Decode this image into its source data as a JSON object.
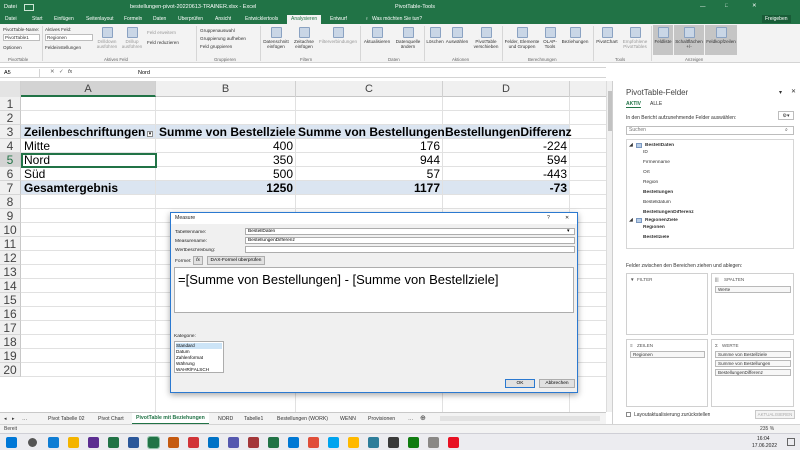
{
  "titlebar": {
    "autosave": "Datei",
    "filename": "bestellungen-pivot-20220613-TRAINER.xlsx - Excel",
    "context": "PivotTable-Tools",
    "user": "Freigeben"
  },
  "ribbon_tabs": [
    "Datei",
    "Start",
    "Einfügen",
    "Seitenlayout",
    "Formeln",
    "Daten",
    "Überprüfen",
    "Ansicht",
    "Entwicklertools",
    "Analysieren",
    "Entwurf"
  ],
  "tell_me": "Was möchten Sie tun?",
  "ribbon": {
    "pt_name_label": "PivotTable-Name:",
    "pt_name": "PivotTable1",
    "options": "Optionen",
    "active_field_label": "Aktives Feld:",
    "active_field": "Regionen",
    "field_settings": "Feldeinstellungen",
    "group_pivottable": "PivotTable",
    "group_active_field": "Aktives Feld",
    "drilldown": "Drilldown ausführen",
    "drillup": "Drillup ausführen",
    "expand": "Feld erweitern",
    "collapse": "Feld reduzieren",
    "group_selection": "Gruppenauswahl",
    "ungroup": "Gruppierung aufheben",
    "group_field": "Feld gruppieren",
    "group_grouping": "Gruppieren",
    "slicer": "Datenschnitt einfügen",
    "timeline": "Zeitachse einfügen",
    "filter_conn": "Filterverbindungen",
    "group_filter": "Filtern",
    "refresh": "Aktualisieren",
    "change_source": "Datenquelle ändern",
    "group_data": "Daten",
    "clear": "Löschen",
    "select": "Auswählen",
    "move": "PivotTable verschieben",
    "group_actions": "Aktionen",
    "fields_items": "Felder, Elemente und Gruppen",
    "olap": "OLAP-Tools",
    "relationships": "Beziehungen",
    "group_calc": "Berechnungen",
    "pivotchart": "PivotChart",
    "recommended": "Empfohlene PivotTables",
    "group_tools": "Tools",
    "field_list": "Feldliste",
    "buttons": "Schaltflächen +/-",
    "headers": "Feldkopfzeilen",
    "group_show": "Anzeigen"
  },
  "formula_bar": {
    "name_box": "A5",
    "fx": "fx",
    "content": "Nord"
  },
  "columns": [
    "A",
    "B",
    "C",
    "D"
  ],
  "rows": [
    "1",
    "2",
    "3",
    "4",
    "5",
    "6",
    "7",
    "8",
    "9",
    "10",
    "11",
    "12",
    "13",
    "14",
    "15",
    "16",
    "17",
    "18",
    "19",
    "20"
  ],
  "pivot": {
    "header": [
      "Zeilenbeschriftungen",
      "Summe von Bestellziele",
      "Summe von Bestellungen",
      "BestellungenDifferenz"
    ],
    "data": [
      [
        "Mitte",
        "400",
        "176",
        "-224"
      ],
      [
        "Nord",
        "350",
        "944",
        "594"
      ],
      [
        "Süd",
        "500",
        "57",
        "-443"
      ]
    ],
    "total": [
      "Gesamtergebnis",
      "1250",
      "1177",
      "-73"
    ]
  },
  "sheet_tabs": [
    "Pivot Tabelle 02",
    "Pivot Chart",
    "PivotTable mit Beziehungen",
    "NORD",
    "Tabelle1",
    "Bestellungen (WORK)",
    "WENN",
    "Provisionen"
  ],
  "status": {
    "mode": "Bereit",
    "zoom": "235 %"
  },
  "pane": {
    "title": "PivotTable-Felder",
    "tab_active": "AKTIV",
    "tab_all": "ALLE",
    "instruction": "In den Bericht aufzunehmende Felder auswählen:",
    "search_placeholder": "Suchen",
    "tables": [
      {
        "name": "BestellDaten",
        "fields": [
          {
            "label": "ID",
            "checked": false
          },
          {
            "label": "Firmenname",
            "checked": false
          },
          {
            "label": "Ort",
            "checked": false
          },
          {
            "label": "Region",
            "checked": false
          },
          {
            "label": "Bestellungen",
            "checked": true
          },
          {
            "label": "Bestelldatum",
            "checked": false
          },
          {
            "label": "BestellungenDifferenz",
            "checked": true
          }
        ]
      },
      {
        "name": "RegionenZiele",
        "fields": [
          {
            "label": "Regionen",
            "checked": true
          },
          {
            "label": "Bestellziele",
            "checked": true
          }
        ]
      }
    ],
    "drag_hint": "Felder zwischen den Bereichen ziehen und ablegen:",
    "area_filter": "FILTER",
    "area_columns": "SPALTEN",
    "area_rows": "ZEILEN",
    "area_values": "WERTE",
    "columns_items": [
      "Werte"
    ],
    "rows_items": [
      "Regionen"
    ],
    "values_items": [
      "Summe von Bestellziele",
      "Summe von Bestellungen",
      "BestellungenDifferenz"
    ],
    "defer_label": "Layoutaktualisierung zurückstellen",
    "update_button": "AKTUALISIEREN"
  },
  "dialog": {
    "title": "Measure",
    "help": "?",
    "close": "✕",
    "table_label": "Tabellenname:",
    "table_value": "BestellDaten",
    "measure_label": "Measurename:",
    "measure_value": "BestellungenDifferenz",
    "desc_label": "Wertbeschreibung:",
    "desc_value": "",
    "formula_label": "Formel:",
    "fx": "fx",
    "dax_check": "DAX-Formel überprüfen",
    "formula": "=[Summe von Bestellungen] - [Summe von Bestellziele]",
    "category_label": "Kategorie:",
    "categories": [
      "Standard",
      "Datum",
      "Zahlenformat",
      "Währung",
      "WAHR/FALSCH"
    ],
    "ok": "OK",
    "cancel": "Abbrechen"
  },
  "taskbar": {
    "time": "16:04",
    "date": "17.06.2022"
  }
}
